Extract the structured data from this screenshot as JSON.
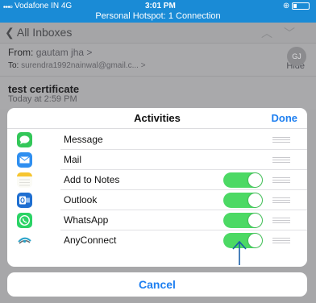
{
  "status_bar": {
    "carrier": "Vodafone IN  4G",
    "time": "3:01 PM",
    "hotspot_text": "Personal Hotspot: 1 Connection"
  },
  "mail_nav": {
    "back_label": "All Inboxes",
    "nav_arrows": "︿﹀"
  },
  "mail_header": {
    "from_label": "From:",
    "from_name": "gautam jha",
    "from_chevron": ">",
    "to_label": "To:",
    "to_address": "surendra1992nainwal@gmail.c...",
    "to_chevron": ">",
    "hide_label": "Hide",
    "avatar_initials": "GJ"
  },
  "message": {
    "subject": "test certificate",
    "date": "Today at 2:59 PM"
  },
  "sheet": {
    "title": "Activities",
    "done_label": "Done",
    "rows": [
      {
        "label": "Message",
        "icon": "message-icon",
        "has_toggle": false
      },
      {
        "label": "Mail",
        "icon": "mail-icon",
        "has_toggle": false
      },
      {
        "label": "Add to Notes",
        "icon": "notes-icon",
        "has_toggle": true,
        "on": true
      },
      {
        "label": "Outlook",
        "icon": "outlook-icon",
        "has_toggle": true,
        "on": true
      },
      {
        "label": "WhatsApp",
        "icon": "whatsapp-icon",
        "has_toggle": true,
        "on": true
      },
      {
        "label": "AnyConnect",
        "icon": "anyconnect-icon",
        "has_toggle": true,
        "on": true
      }
    ]
  },
  "cancel_label": "Cancel",
  "colors": {
    "status_bar": "#1a8bd6",
    "accent_blue": "#1e7ff0",
    "toggle_on": "#4cd964",
    "annotation_arrow": "#1b5fa8"
  }
}
